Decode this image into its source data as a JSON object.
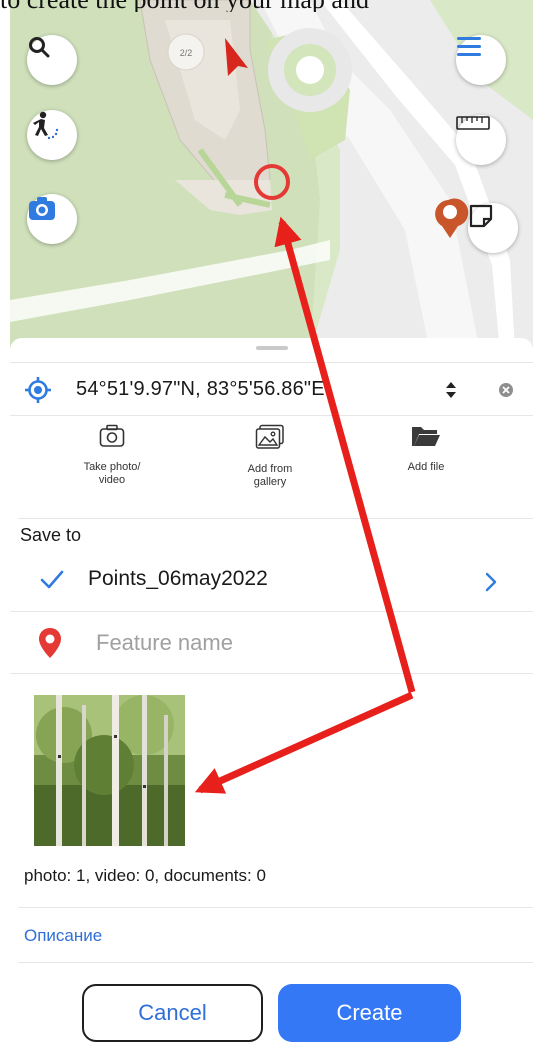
{
  "caption": "to create the point on your map and",
  "map": {
    "floor_label": "2/2",
    "buttons": {
      "search": "search-icon",
      "track": "walking-track-icon",
      "camera": "camera-icon",
      "menu": "menu-icon",
      "ruler": "ruler-icon",
      "area": "area-measure-icon"
    }
  },
  "point": {
    "coordinates": "54°51'9.97\"N, 83°5'56.86\"E"
  },
  "attachments": [
    {
      "label_line1": "Take photo/",
      "label_line2": "video",
      "icon": "camera-icon"
    },
    {
      "label_line1": "Add from",
      "label_line2": "gallery",
      "icon": "gallery-icon"
    },
    {
      "label_line1": "Add file",
      "label_line2": "",
      "icon": "folder-icon"
    }
  ],
  "save_to_label": "Save to",
  "layer_name": "Points_06may2022",
  "feature_placeholder": "Feature name",
  "media_counts": "photo: 1, video: 0, documents: 0",
  "description_label": "Описание",
  "actions": {
    "cancel": "Cancel",
    "create": "Create"
  },
  "colors": {
    "accent": "#3478f6",
    "link": "#2f6fd6",
    "marker": "#e53935",
    "annotation_arrow": "#e8201c",
    "map_green": "#d9e8c7"
  }
}
